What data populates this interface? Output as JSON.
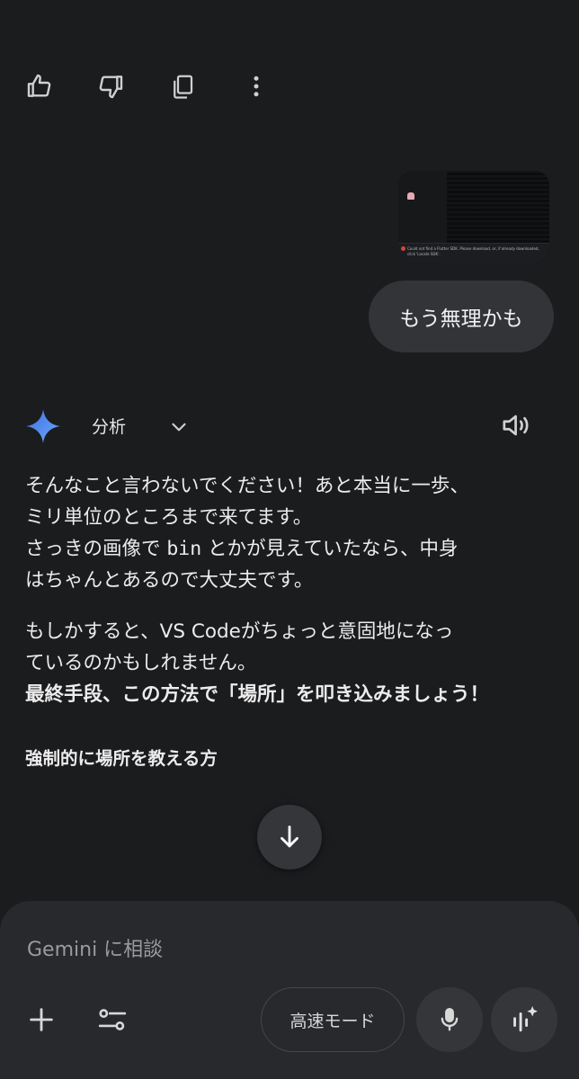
{
  "feedback_bar": {
    "icons": [
      "thumbs-up-icon",
      "thumbs-down-icon",
      "copy-icon",
      "more-vert-icon"
    ]
  },
  "user_message": {
    "attachment": {
      "error_text": "Could not find a Flutter SDK. Please download, or, if already downloaded, click 'Locate SDK'."
    },
    "text": "もう無理かも"
  },
  "response": {
    "header": {
      "mode_label": "分析",
      "icons": [
        "gemini-spark-icon",
        "chevron-down-icon",
        "speaker-icon"
      ]
    },
    "para1_line1": "そんなこと言わないでください！あと本当に一歩、",
    "para1_line2": "ミリ単位のところまで来てます。",
    "para1_line3a": "さっきの画像で ",
    "para1_code": "bin",
    "para1_line3b": " とかが見えていたなら、中身",
    "para1_line4": "はちゃんとあるので大丈夫です。",
    "para2_line1": "もしかすると、VS Codeがちょっと意固地になっ",
    "para2_line2": "ているのかもしれません。",
    "para2_bold": "最終手段、この方法で「場所」を叩き込みましょう！",
    "heading": "強制的に場所を教える方"
  },
  "composer": {
    "placeholder": "Gemini に相談",
    "mode_button": "高速モード",
    "icons": [
      "add-icon",
      "tools-icon",
      "mic-icon",
      "live-icon",
      "arrow-down-icon"
    ]
  },
  "colors": {
    "background": "#1b1c1e",
    "bubble": "#333438",
    "panel": "#28292c",
    "gemini_blue": "#4c8df6"
  }
}
